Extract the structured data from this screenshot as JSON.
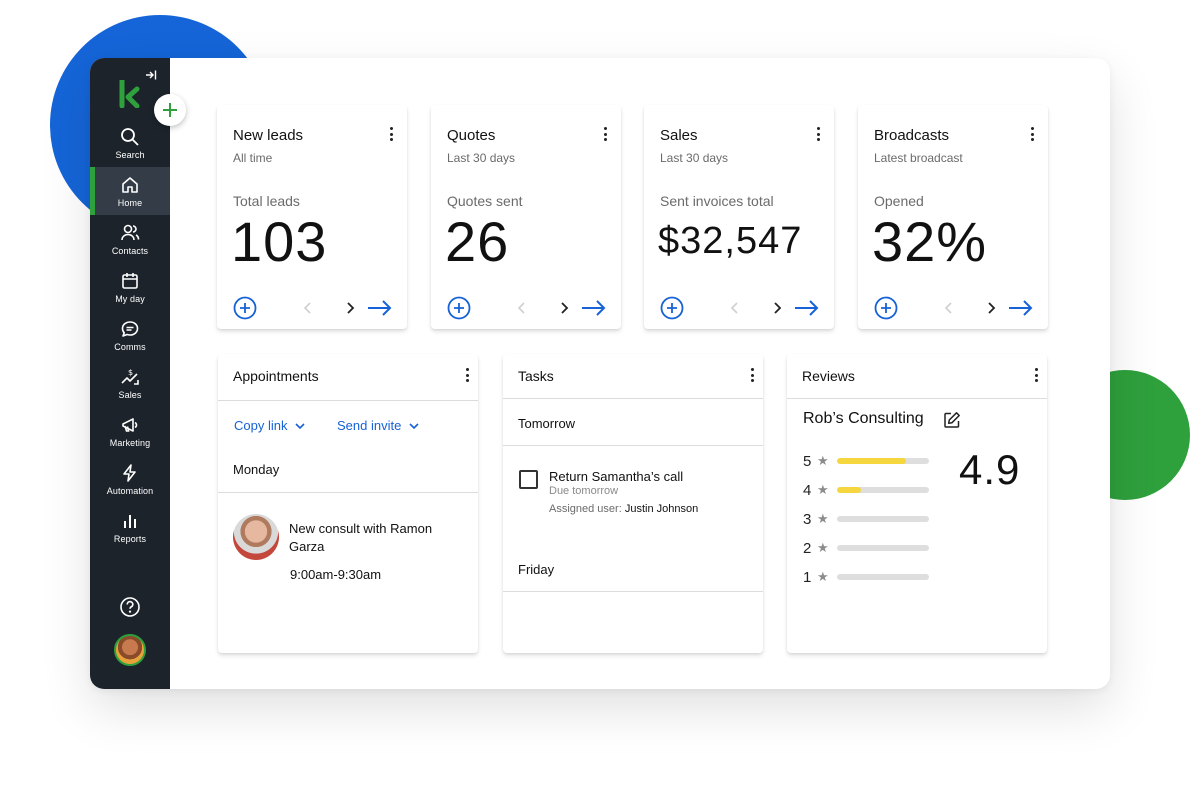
{
  "brand": {
    "accent": "#2ea03c",
    "link": "#1662d6",
    "sidebar_bg": "#1c232b"
  },
  "sidebar": {
    "logo": "k",
    "items": [
      {
        "label": "Search",
        "icon": "search-icon"
      },
      {
        "label": "Home",
        "icon": "home-icon",
        "active": true
      },
      {
        "label": "Contacts",
        "icon": "contacts-icon"
      },
      {
        "label": "My day",
        "icon": "calendar-icon"
      },
      {
        "label": "Comms",
        "icon": "chat-icon"
      },
      {
        "label": "Sales",
        "icon": "sales-icon"
      },
      {
        "label": "Marketing",
        "icon": "megaphone-icon"
      },
      {
        "label": "Automation",
        "icon": "lightning-icon"
      },
      {
        "label": "Reports",
        "icon": "bar-chart-icon"
      }
    ]
  },
  "kpis": [
    {
      "title": "New leads",
      "subtitle": "All time",
      "label": "Total leads",
      "value": "103"
    },
    {
      "title": "Quotes",
      "subtitle": "Last 30 days",
      "label": "Quotes sent",
      "value": "26"
    },
    {
      "title": "Sales",
      "subtitle": "Last 30 days",
      "label": "Sent invoices total",
      "value": "$32,547"
    },
    {
      "title": "Broadcasts",
      "subtitle": "Latest broadcast",
      "label": "Opened",
      "value": "32%"
    }
  ],
  "appointments": {
    "title": "Appointments",
    "copy_link": "Copy link",
    "send_invite": "Send invite",
    "day": "Monday",
    "event_title": "New consult with Ramon Garza",
    "event_time": "9:00am-9:30am"
  },
  "tasks": {
    "title": "Tasks",
    "day1": "Tomorrow",
    "task_title": "Return Samantha’s call",
    "task_due": "Due tomorrow",
    "assigned_label": "Assigned user:",
    "assigned_user": "Justin Johnson",
    "day2": "Friday"
  },
  "reviews": {
    "title": "Reviews",
    "business": "Rob’s Consulting",
    "average": "4.9",
    "star_glyph": "★",
    "ratings": [
      {
        "stars": "5",
        "share": 0.75
      },
      {
        "stars": "4",
        "share": 0.26
      },
      {
        "stars": "3",
        "share": 0
      },
      {
        "stars": "2",
        "share": 0
      },
      {
        "stars": "1",
        "share": 0
      }
    ]
  }
}
